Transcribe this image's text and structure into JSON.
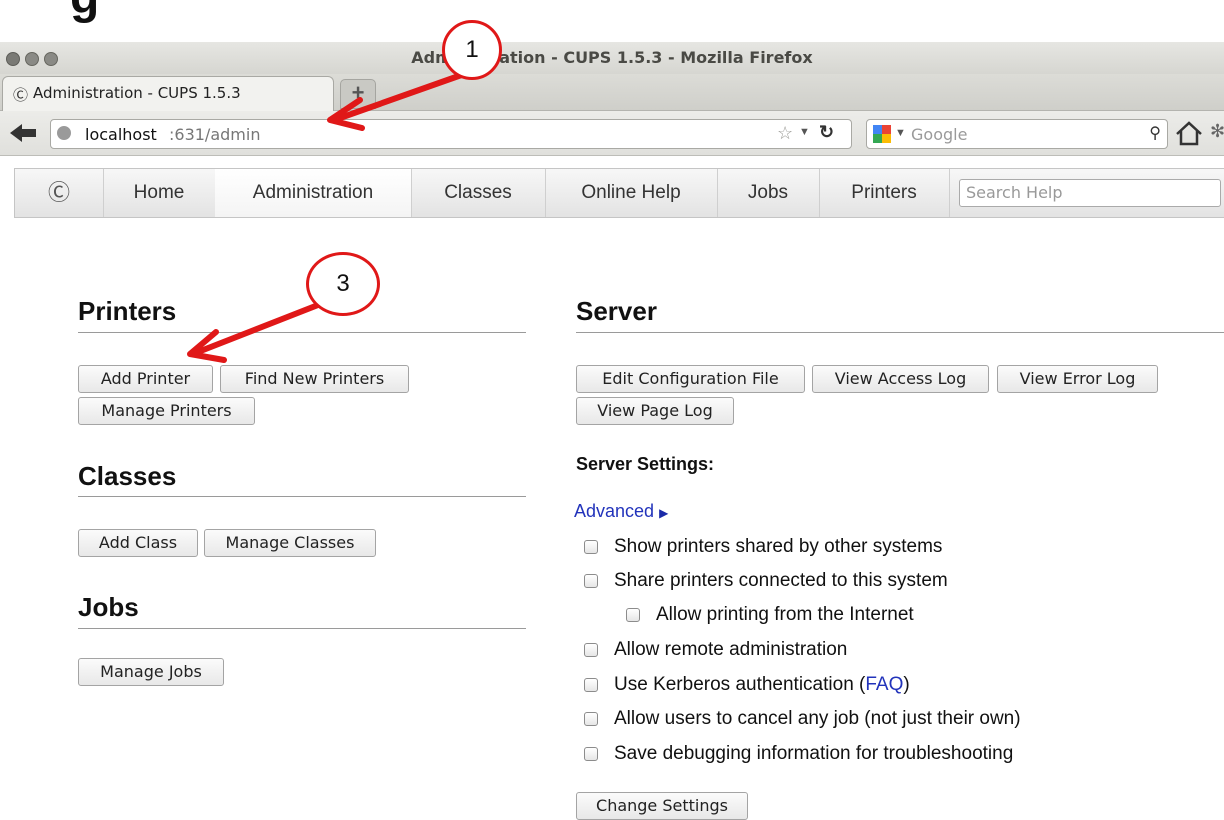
{
  "heading_partial": "g",
  "window": {
    "title": "Administration - CUPS 1.5.3 - Mozilla Firefox"
  },
  "tab": {
    "title": "Administration - CUPS 1.5.3",
    "new_tab": "+"
  },
  "navbar": {
    "url_host": "localhost",
    "url_rest": ":631/admin",
    "search_engine_placeholder": "Google"
  },
  "cups_nav": {
    "items": [
      "Home",
      "Administration",
      "Classes",
      "Online Help",
      "Jobs",
      "Printers"
    ],
    "search_placeholder": "Search Help",
    "active": "Administration"
  },
  "printers": {
    "heading": "Printers",
    "buttons": [
      "Add Printer",
      "Find New Printers",
      "Manage Printers"
    ]
  },
  "classes": {
    "heading": "Classes",
    "buttons": [
      "Add Class",
      "Manage Classes"
    ]
  },
  "jobs": {
    "heading": "Jobs",
    "buttons": [
      "Manage Jobs"
    ]
  },
  "server": {
    "heading": "Server",
    "buttons": [
      "Edit Configuration File",
      "View Access Log",
      "View Error Log",
      "View Page Log"
    ],
    "settings_label": "Server Settings:",
    "advanced_link": "Advanced",
    "options": [
      "Show printers shared by other systems",
      "Share printers connected to this system",
      "Allow printing from the Internet",
      "Allow remote administration",
      "Use Kerberos authentication (",
      "Allow users to cancel any job (not just their own)",
      "Save debugging information for troubleshooting"
    ],
    "faq_link": "FAQ",
    "faq_close": ")",
    "change_settings": "Change Settings"
  },
  "annotations": {
    "callout_1": "1",
    "callout_3": "3",
    "color": "#e01818"
  },
  "colors": {
    "link": "#2233bb",
    "annotation": "#e01818"
  }
}
